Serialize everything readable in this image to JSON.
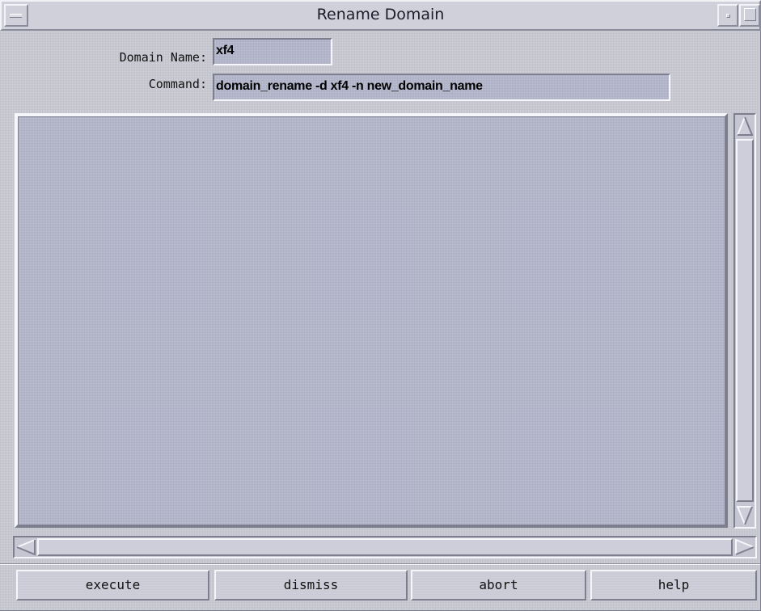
{
  "window": {
    "title": "Rename Domain"
  },
  "form": {
    "domain_name_label": "Domain Name:",
    "domain_name_value": "xf4",
    "command_label": "Command:",
    "command_value": "domain_rename -d xf4 -n  new_domain_name"
  },
  "output": {
    "text": ""
  },
  "buttons": {
    "execute": "execute",
    "dismiss": "dismiss",
    "abort": "abort",
    "help": "help"
  },
  "icons": {
    "window_menu": "window-menu-icon",
    "minimize": "minimize-icon",
    "maximize": "maximize-icon",
    "scroll_up": "triangle-up-icon",
    "scroll_down": "triangle-down-icon",
    "scroll_left": "triangle-left-icon",
    "scroll_right": "triangle-right-icon"
  },
  "colors": {
    "background": "#c9cad5",
    "field_background": "#b3b5cb",
    "text": "#111111"
  }
}
